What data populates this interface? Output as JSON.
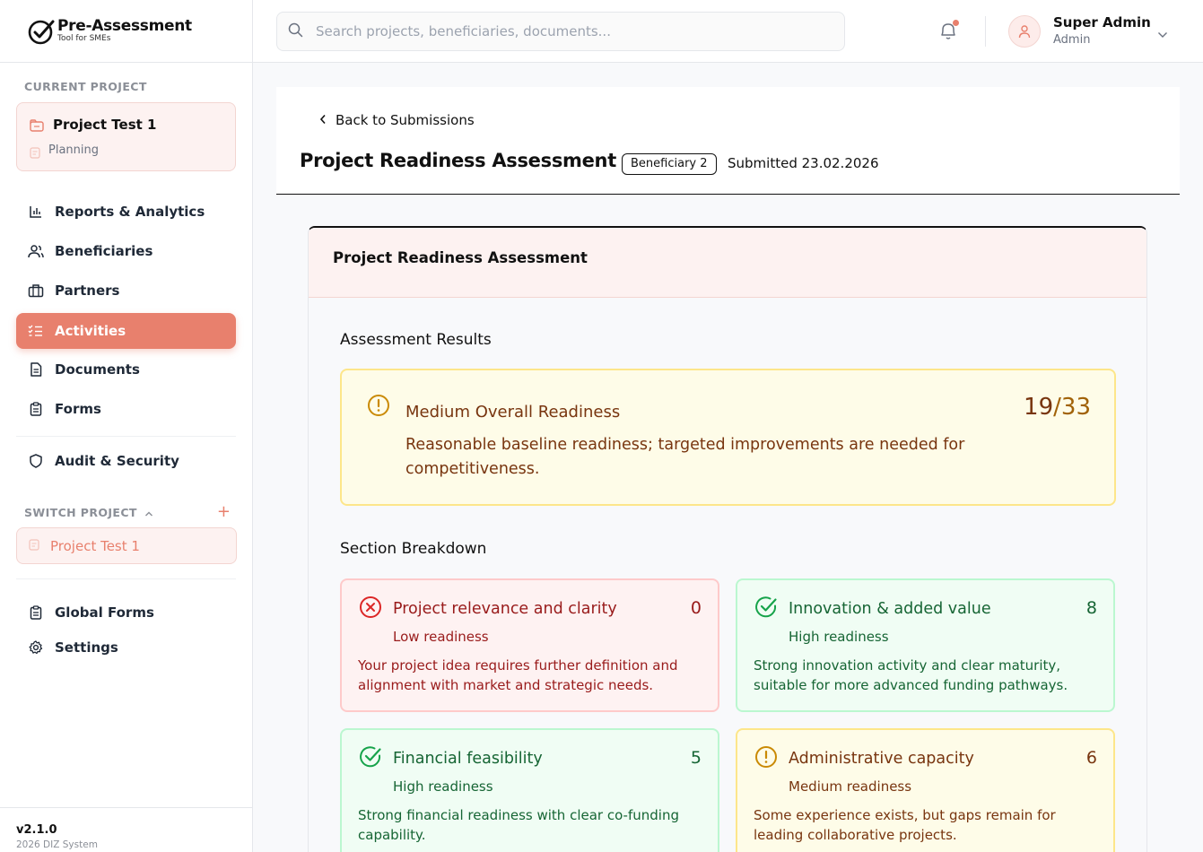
{
  "app": {
    "title": "Pre-Assessment",
    "subtitle": "Tool for SMEs"
  },
  "sidebar": {
    "current_project_label": "CURRENT PROJECT",
    "current_project": {
      "name": "Project Test 1",
      "phase": "Planning"
    },
    "nav": [
      {
        "label": "Reports & Analytics",
        "icon": "bar-chart-icon"
      },
      {
        "label": "Beneficiaries",
        "icon": "users-icon"
      },
      {
        "label": "Partners",
        "icon": "briefcase-icon"
      },
      {
        "label": "Activities",
        "icon": "list-check-icon",
        "active": true
      },
      {
        "label": "Documents",
        "icon": "document-icon"
      },
      {
        "label": "Forms",
        "icon": "clipboard-icon"
      }
    ],
    "audit_label": "Audit & Security",
    "switch_project_label": "SWITCH PROJECT",
    "switch_projects": [
      "Project Test 1"
    ],
    "global_forms_label": "Global Forms",
    "settings_label": "Settings",
    "version": "v2.1.0",
    "copyright": "2026 DIZ System"
  },
  "header": {
    "search_placeholder": "Search projects, beneficiaries, documents...",
    "user": {
      "name": "Super Admin",
      "role": "Admin"
    }
  },
  "page": {
    "back_label": "Back to Submissions",
    "title": "Project Readiness Assessment",
    "badge": "Beneficiary 2",
    "submitted": "Submitted 23.02.2026"
  },
  "assessment": {
    "card_title": "Project Readiness Assessment",
    "results_title": "Assessment Results",
    "overall": {
      "level": "Medium Overall Readiness",
      "description": "Reasonable baseline readiness; targeted improvements are needed for competitiveness.",
      "score": "19",
      "separator": "/",
      "max": "33"
    },
    "breakdown_title": "Section Breakdown",
    "sections": [
      {
        "name": "Project relevance and clarity",
        "score": "0",
        "level": "Low readiness",
        "description": "Your project idea requires further definition and alignment with market and strategic needs.",
        "status": "low"
      },
      {
        "name": "Innovation & added value",
        "score": "8",
        "level": "High readiness",
        "description": "Strong innovation activity and clear maturity, suitable for more advanced funding pathways.",
        "status": "high"
      },
      {
        "name": "Financial feasibility",
        "score": "5",
        "level": "High readiness",
        "description": "Strong financial readiness with clear co-funding capability.",
        "status": "high"
      },
      {
        "name": "Administrative capacity",
        "score": "6",
        "level": "Medium readiness",
        "description": "Some experience exists, but gaps remain for leading collaborative projects.",
        "status": "medium"
      }
    ]
  },
  "colors": {
    "accent": "#e8806d",
    "low": "#dc2626",
    "high": "#16a34a",
    "medium": "#ca8a04"
  }
}
